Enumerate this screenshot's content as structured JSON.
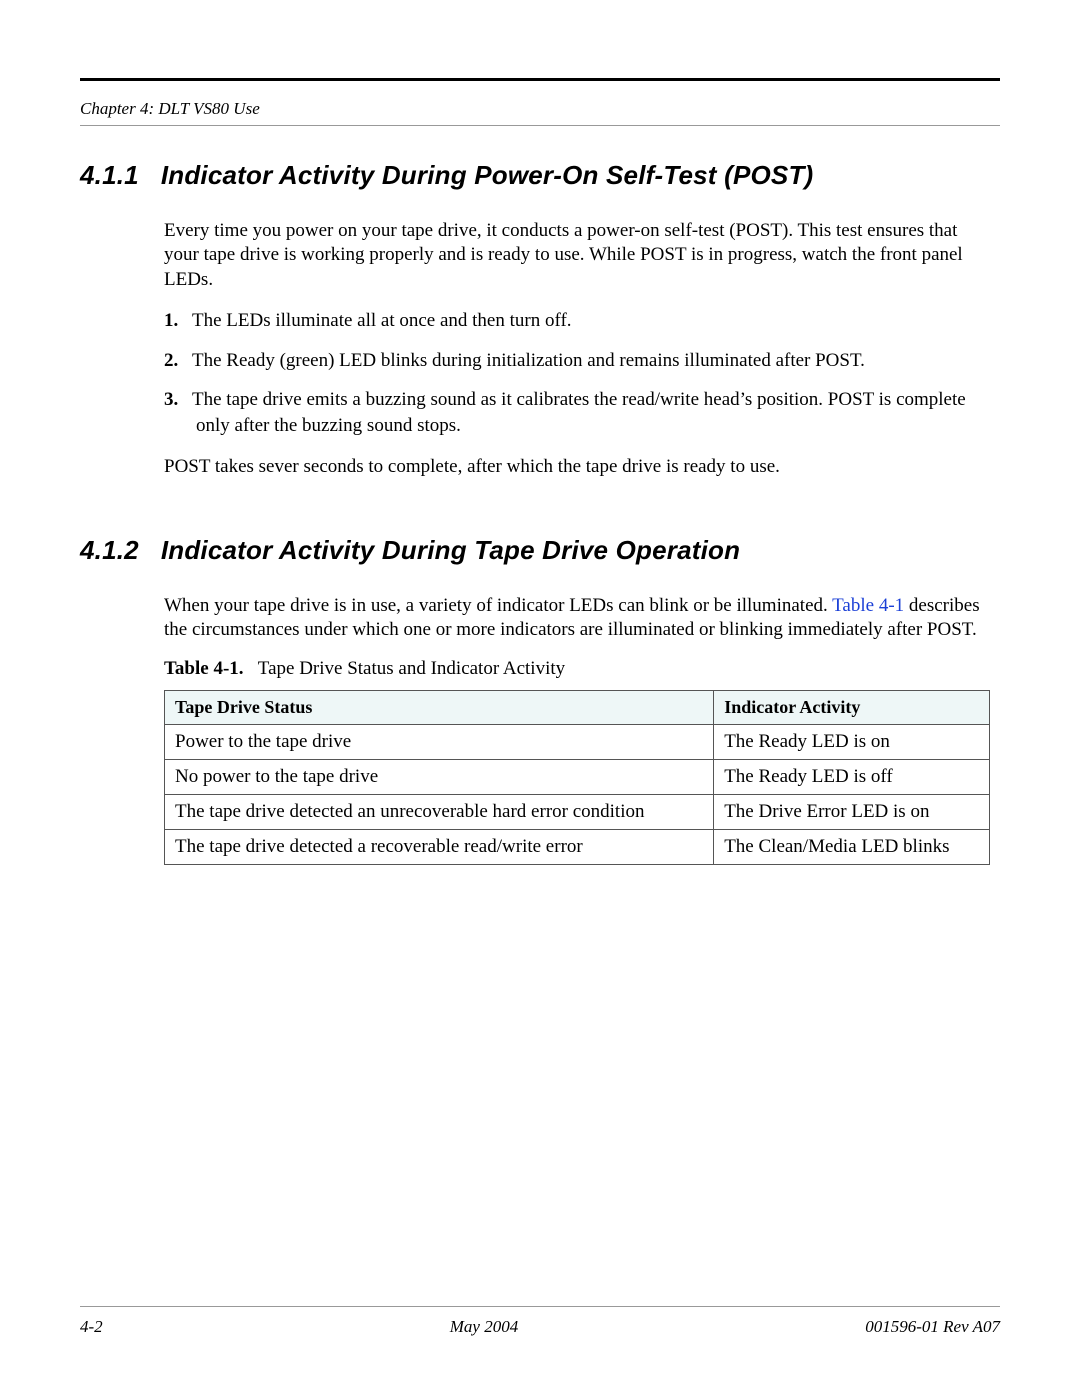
{
  "header": {
    "chapter_line": "Chapter 4:  DLT VS80 Use"
  },
  "section_411": {
    "number": "4.1.1",
    "title": "Indicator Activity During Power-On Self-Test (POST)",
    "intro": "Every time you power on your tape drive, it conducts a power-on self-test (POST). This test ensures that your tape drive is working properly and is ready to use. While POST is in progress, watch the front panel LEDs.",
    "list": [
      "The LEDs illuminate all at once and then turn off.",
      "The Ready (green) LED blinks during initialization and remains illuminated after POST.",
      "The tape drive emits a buzzing sound as it calibrates the read/write head’s position. POST is complete only after the buzzing sound stops."
    ],
    "outro": "POST takes sever seconds to complete, after which the tape drive is ready to use."
  },
  "section_412": {
    "number": "4.1.2",
    "title": "Indicator Activity During Tape Drive Operation",
    "intro_pre": "When your tape drive is in use, a variety of indicator LEDs can blink or be illuminated. ",
    "intro_link": "Table 4-1",
    "intro_post": " describes the circumstances under which one or more indicators are illuminated or blinking immediately after POST.",
    "table_caption_label": "Table 4-1.",
    "table_caption_text": "Tape Drive Status and Indicator Activity",
    "table": {
      "headers": [
        "Tape Drive Status",
        "Indicator Activity"
      ],
      "rows": [
        [
          "Power to the tape drive",
          "The Ready LED is on"
        ],
        [
          "No power to the tape drive",
          "The Ready LED is off"
        ],
        [
          "The tape drive detected an unrecoverable hard error condition",
          "The Drive Error LED is on"
        ],
        [
          "The tape drive detected a recoverable read/write error",
          "The Clean/Media LED blinks"
        ]
      ]
    }
  },
  "footer": {
    "page": "4-2",
    "date": "May 2004",
    "doc": "001596-01 Rev A07"
  }
}
